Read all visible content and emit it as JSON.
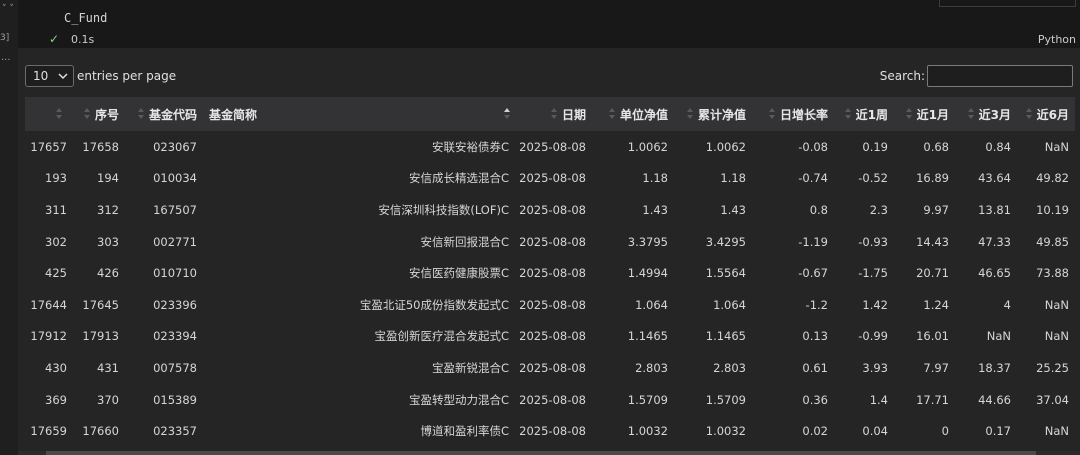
{
  "gutter": {
    "chevron": "˅ ˅",
    "exec_count": "3]",
    "more": "..."
  },
  "cell": {
    "code": "C_Fund",
    "status_time": "0.1s",
    "language": "Python"
  },
  "controls": {
    "page_length": "10",
    "page_length_label": "entries per page",
    "search_label": "Search:",
    "search_value": ""
  },
  "table": {
    "headers": [
      "",
      "序号",
      "基金代码",
      "基金简称",
      "日期",
      "单位净值",
      "累计净值",
      "日增长率",
      "近1周",
      "近1月",
      "近3月",
      "近6月"
    ],
    "sorted_column": "基金简称",
    "rows": [
      [
        "17657",
        "17658",
        "023067",
        "安联安裕债券C",
        "2025-08-08",
        "1.0062",
        "1.0062",
        "-0.08",
        "0.19",
        "0.68",
        "0.84",
        "NaN"
      ],
      [
        "193",
        "194",
        "010034",
        "安信成长精选混合C",
        "2025-08-08",
        "1.18",
        "1.18",
        "-0.74",
        "-0.52",
        "16.89",
        "43.64",
        "49.82"
      ],
      [
        "311",
        "312",
        "167507",
        "安信深圳科技指数(LOF)C",
        "2025-08-08",
        "1.43",
        "1.43",
        "0.8",
        "2.3",
        "9.97",
        "13.81",
        "10.19"
      ],
      [
        "302",
        "303",
        "002771",
        "安信新回报混合C",
        "2025-08-08",
        "3.3795",
        "3.4295",
        "-1.19",
        "-0.93",
        "14.43",
        "47.33",
        "49.85"
      ],
      [
        "425",
        "426",
        "010710",
        "安信医药健康股票C",
        "2025-08-08",
        "1.4994",
        "1.5564",
        "-0.67",
        "-1.75",
        "20.71",
        "46.65",
        "73.88"
      ],
      [
        "17644",
        "17645",
        "023396",
        "宝盈北证50成份指数发起式C",
        "2025-08-08",
        "1.064",
        "1.064",
        "-1.2",
        "1.42",
        "1.24",
        "4",
        "NaN"
      ],
      [
        "17912",
        "17913",
        "023394",
        "宝盈创新医疗混合发起式C",
        "2025-08-08",
        "1.1465",
        "1.1465",
        "0.13",
        "-0.99",
        "16.01",
        "NaN",
        "NaN"
      ],
      [
        "430",
        "431",
        "007578",
        "宝盈新锐混合C",
        "2025-08-08",
        "2.803",
        "2.803",
        "0.61",
        "3.93",
        "7.97",
        "18.37",
        "25.25"
      ],
      [
        "369",
        "370",
        "015389",
        "宝盈转型动力混合C",
        "2025-08-08",
        "1.5709",
        "1.5709",
        "0.36",
        "1.4",
        "17.71",
        "44.66",
        "37.04"
      ],
      [
        "17659",
        "17660",
        "023357",
        "博道和盈利率债C",
        "2025-08-08",
        "1.0032",
        "1.0032",
        "0.02",
        "0.04",
        "0",
        "0.17",
        "NaN"
      ]
    ]
  },
  "colors": {
    "background": "#1f1f1f",
    "output_bg": "#252526",
    "header_bg": "#333336",
    "check": "#89d185"
  }
}
